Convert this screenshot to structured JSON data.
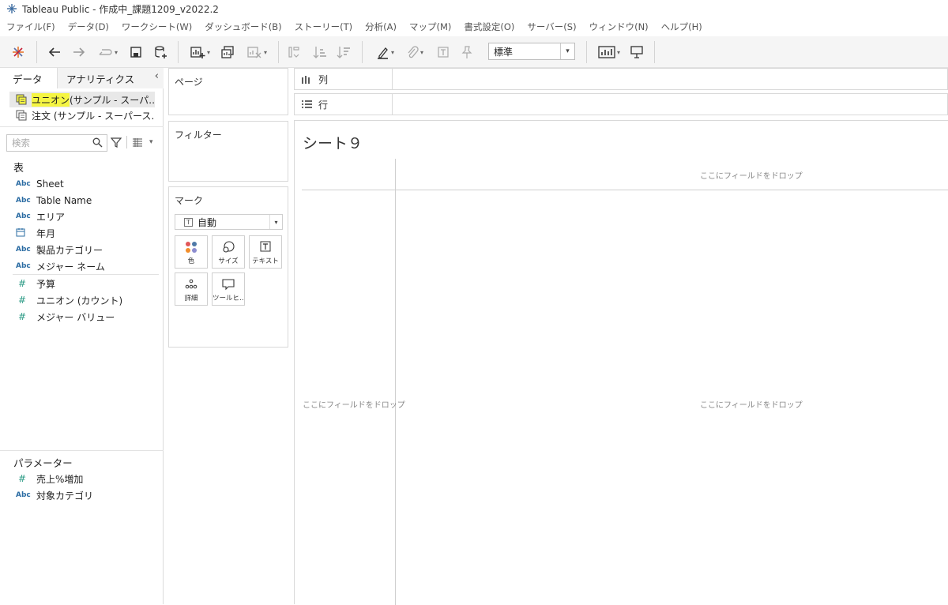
{
  "window": {
    "title": "Tableau Public - 作成中_課題1209_v2022.2"
  },
  "menu": [
    "ファイル(F)",
    "データ(D)",
    "ワークシート(W)",
    "ダッシュボード(B)",
    "ストーリー(T)",
    "分析(A)",
    "マップ(M)",
    "書式設定(O)",
    "サーバー(S)",
    "ウィンドウ(N)",
    "ヘルプ(H)"
  ],
  "toolbar": {
    "fit_select": "標準"
  },
  "left_pane": {
    "tabs": {
      "data": "データ",
      "analytics": "アナリティクス"
    },
    "data_sources": [
      {
        "name_highlight": "ユニオン",
        "name_rest": " (サンプル - スーパ…"
      },
      {
        "name_highlight": "",
        "name_rest": "注文 (サンプル - スーパース…"
      }
    ],
    "search_placeholder": "検索",
    "tables_header": "表",
    "dimensions": [
      {
        "type": "Abc",
        "name": "Sheet"
      },
      {
        "type": "Abc",
        "name": "Table Name"
      },
      {
        "type": "Abc",
        "name": "エリア"
      },
      {
        "type": "date",
        "name": "年月"
      },
      {
        "type": "Abc",
        "name": "製品カテゴリー"
      },
      {
        "type": "Abc",
        "name": "メジャー ネーム"
      }
    ],
    "measures": [
      {
        "type": "#",
        "name": "予算"
      },
      {
        "type": "#",
        "name": "ユニオン (カウント)"
      },
      {
        "type": "#",
        "name": "メジャー バリュー"
      }
    ],
    "parameters_header": "パラメーター",
    "parameters": [
      {
        "type": "#",
        "name": "売上%増加"
      },
      {
        "type": "Abc",
        "name": "対象カテゴリ"
      }
    ]
  },
  "cards": {
    "pages": "ページ",
    "filters": "フィルター",
    "marks": "マーク",
    "marks_type": "自動",
    "mark_buttons": {
      "color": "色",
      "size": "サイズ",
      "text": "テキスト",
      "detail": "詳細",
      "tooltip": "ツールヒ…"
    }
  },
  "shelves": {
    "columns": "列",
    "rows": "行"
  },
  "sheet": {
    "title": "シート９",
    "drop_top": "ここにフィールドをドロップ",
    "drop_left": "ここにフィールドをドロップ",
    "drop_center": "ここにフィールドをドロップ"
  }
}
